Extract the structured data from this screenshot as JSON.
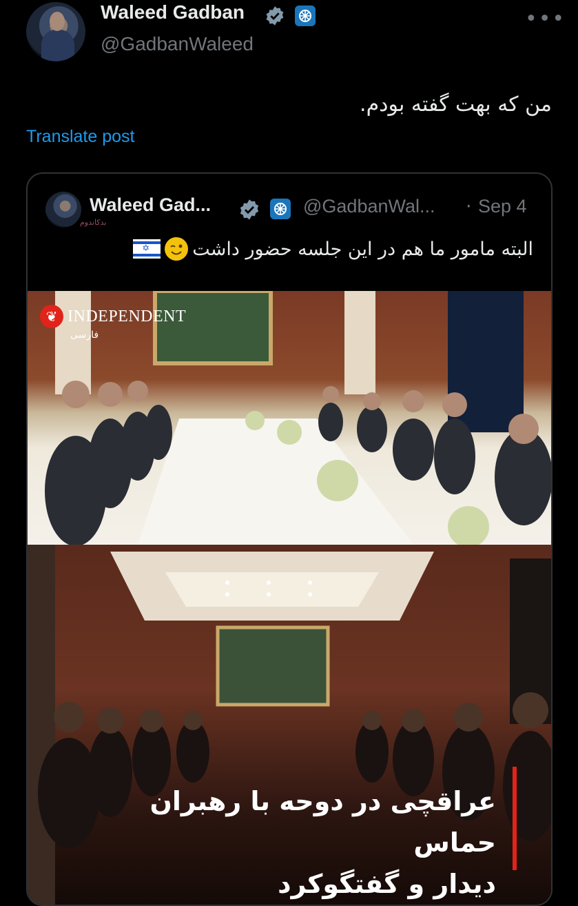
{
  "author": {
    "name": "Waleed Gadban",
    "handle": "@GadbanWaleed"
  },
  "more_label": "•••",
  "tweet_text": "من که بهت گفته بودم.",
  "translate_label": "Translate post",
  "quote": {
    "name": "Waleed Gad...",
    "handle": "@GadbanWal...",
    "separator": "·",
    "date": "Sep 4",
    "sub_label": "بدکاندوم",
    "text": "البته مامور ما هم در این جلسه حضور داشت"
  },
  "image": {
    "logo_text": "INDEPENDENT",
    "logo_sub": "فارسی",
    "headline_line1": "عراقچی در دوحه با رهبران حماس",
    "headline_line2": "دیدار و گفتگوکرد"
  },
  "colors": {
    "background": "#000000",
    "link": "#1d9bf0",
    "secondary_text": "#71767b",
    "verified": "#829aab",
    "independent_red": "#e2231a"
  },
  "icons": [
    "verified-badge-icon",
    "emblem-badge-icon",
    "more-options-icon",
    "wink-emoji-icon",
    "israel-flag-icon"
  ]
}
